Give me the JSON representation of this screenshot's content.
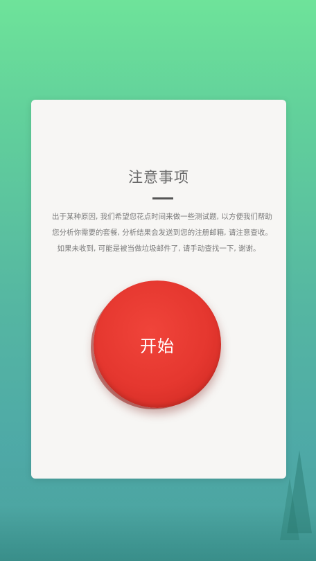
{
  "notice": {
    "title": "注意事项",
    "lines": [
      "出于某种原因, 我们希望您花点时间来做一些测试题, 以方便我们帮助",
      "您分析你需要的套餐, 分析结果会发送到您的注册邮箱, 请注意查收。",
      "如果未收到, 可能是被当做垃圾邮件了, 请手动查找一下, 谢谢。"
    ]
  },
  "start_button": {
    "label": "开始",
    "color": "#e5372f"
  },
  "colors": {
    "background_top": "#6ee39a",
    "background_bottom": "#449a99",
    "card": "#f7f6f4"
  }
}
